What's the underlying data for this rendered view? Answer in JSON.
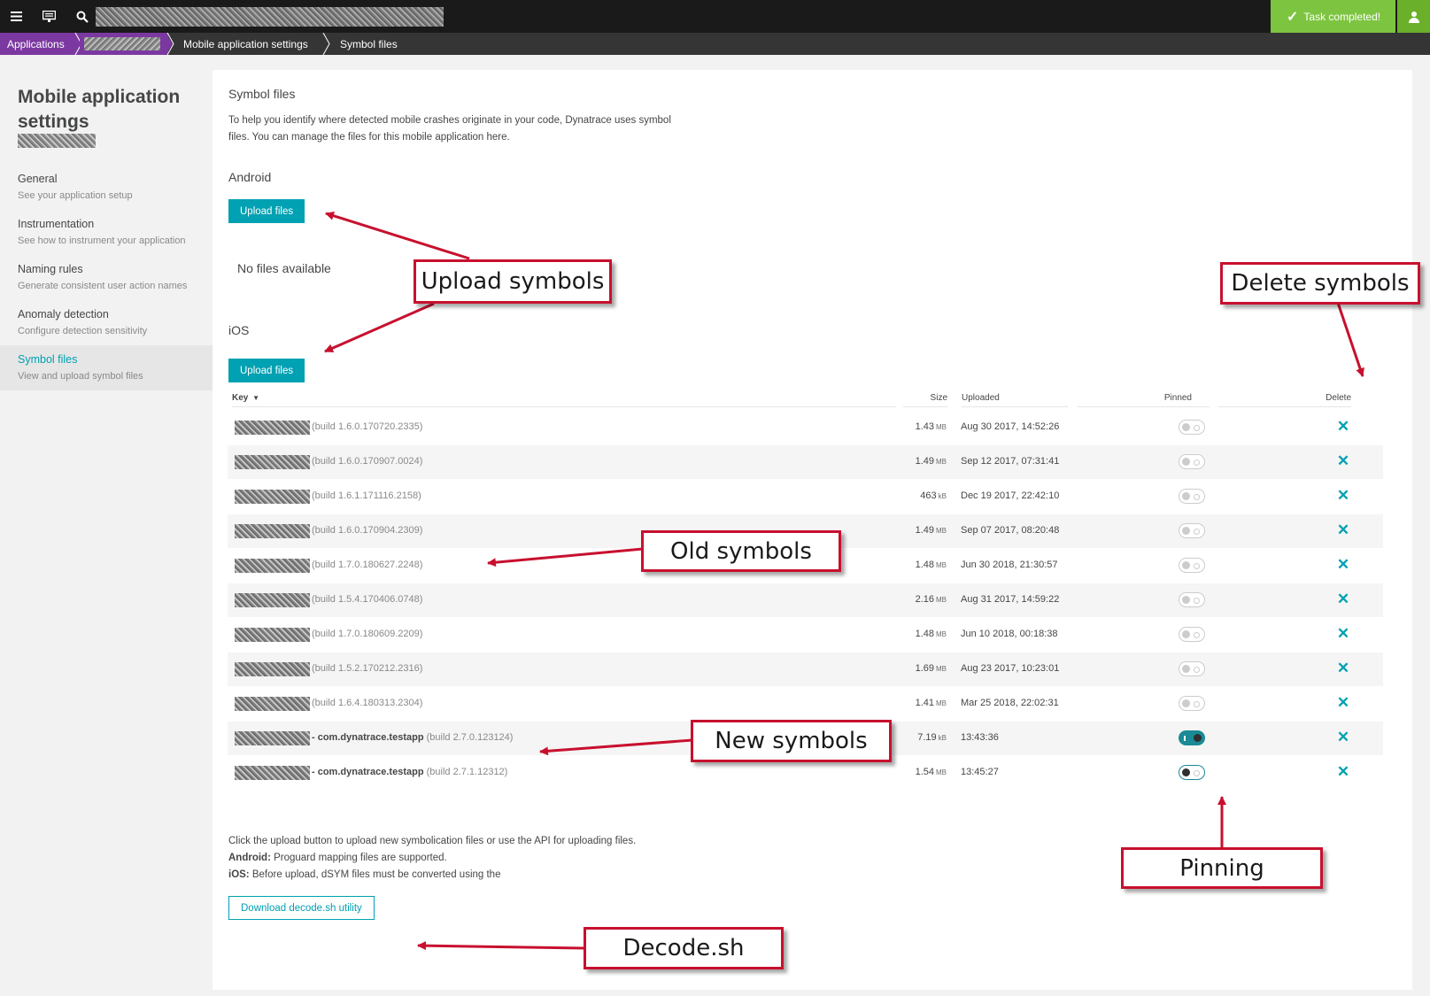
{
  "topbar": {
    "menu_icon": "hamburger-icon",
    "monitor_icon": "monitor-icon",
    "search_icon": "search-icon",
    "task_status": "Task completed!",
    "check_icon": "check-icon",
    "user_icon": "user-icon",
    "colors": {
      "bar": "#1a1a1a",
      "task": "#7dc540"
    }
  },
  "breadcrumb": {
    "items": [
      "Applications",
      "Mobile application settings",
      "Symbol files"
    ],
    "accent": "#7c38a1"
  },
  "sidebar": {
    "title": "Mobile application settings",
    "items": [
      {
        "label": "General",
        "desc": "See your application setup"
      },
      {
        "label": "Instrumentation",
        "desc": "See how to instrument your application"
      },
      {
        "label": "Naming rules",
        "desc": "Generate consistent user action names"
      },
      {
        "label": "Anomaly detection",
        "desc": "Configure detection sensitivity"
      },
      {
        "label": "Symbol files",
        "desc": "View and upload symbol files"
      }
    ]
  },
  "main": {
    "title": "Symbol files",
    "intro": "To help you identify where detected mobile crashes originate in your code, Dynatrace uses symbol files. You can manage the files for this mobile application here.",
    "android": {
      "heading": "Android",
      "upload_label": "Upload files",
      "empty_text": "No files available"
    },
    "ios": {
      "heading": "iOS",
      "upload_label": "Upload files"
    },
    "table": {
      "headers": {
        "key": "Key",
        "size": "Size",
        "uploaded": "Uploaded",
        "pinned": "Pinned",
        "delete": "Delete"
      },
      "sort_icon": "sort-desc-icon",
      "delete_icon": "close-icon",
      "rows": [
        {
          "pkg": "",
          "build": "(build 1.6.0.170720.2335)",
          "size": "1.43",
          "unit": "MB",
          "uploaded": "Aug 30 2017, 14:52:26",
          "pinned": false
        },
        {
          "pkg": "",
          "build": "(build 1.6.0.170907.0024)",
          "size": "1.49",
          "unit": "MB",
          "uploaded": "Sep 12 2017, 07:31:41",
          "pinned": false
        },
        {
          "pkg": "",
          "build": "(build 1.6.1.171116.2158)",
          "size": "463",
          "unit": "kB",
          "uploaded": "Dec 19 2017, 22:42:10",
          "pinned": false
        },
        {
          "pkg": "",
          "build": "(build 1.6.0.170904.2309)",
          "size": "1.49",
          "unit": "MB",
          "uploaded": "Sep 07 2017, 08:20:48",
          "pinned": false
        },
        {
          "pkg": "",
          "build": "(build 1.7.0.180627.2248)",
          "size": "1.48",
          "unit": "MB",
          "uploaded": "Jun 30 2018, 21:30:57",
          "pinned": false
        },
        {
          "pkg": "",
          "build": "(build 1.5.4.170406.0748)",
          "size": "2.16",
          "unit": "MB",
          "uploaded": "Aug 31 2017, 14:59:22",
          "pinned": false
        },
        {
          "pkg": "",
          "build": "(build 1.7.0.180609.2209)",
          "size": "1.48",
          "unit": "MB",
          "uploaded": "Jun 10 2018, 00:18:38",
          "pinned": false
        },
        {
          "pkg": "",
          "build": "(build 1.5.2.170212.2316)",
          "size": "1.69",
          "unit": "MB",
          "uploaded": "Aug 23 2017, 10:23:01",
          "pinned": false
        },
        {
          "pkg": "",
          "build": "(build 1.6.4.180313.2304)",
          "size": "1.41",
          "unit": "MB",
          "uploaded": "Mar 25 2018, 22:02:31",
          "pinned": false
        },
        {
          "pkg": "- com.dynatrace.testapp",
          "build": "(build 2.7.0.123124)",
          "size": "7.19",
          "unit": "kB",
          "uploaded": "13:43:36",
          "pinned": true
        },
        {
          "pkg": "- com.dynatrace.testapp",
          "build": "(build 2.7.1.12312)",
          "size": "1.54",
          "unit": "MB",
          "uploaded": "13:45:27",
          "pinned": false
        }
      ]
    },
    "footer": {
      "line1": "Click the upload button to upload new symbolication files or use the API for uploading files.",
      "android_label": "Android:",
      "android_text": " Proguard mapping files are supported.",
      "ios_label": "iOS:",
      "ios_text": " Before upload, dSYM files must be converted using the",
      "download_label": "Download decode.sh utility"
    }
  },
  "annotations": {
    "upload": "Upload symbols",
    "delete": "Delete symbols",
    "old": "Old symbols",
    "new": "New symbols",
    "pinning": "Pinning",
    "decode": "Decode.sh",
    "color": "#c8102e"
  }
}
